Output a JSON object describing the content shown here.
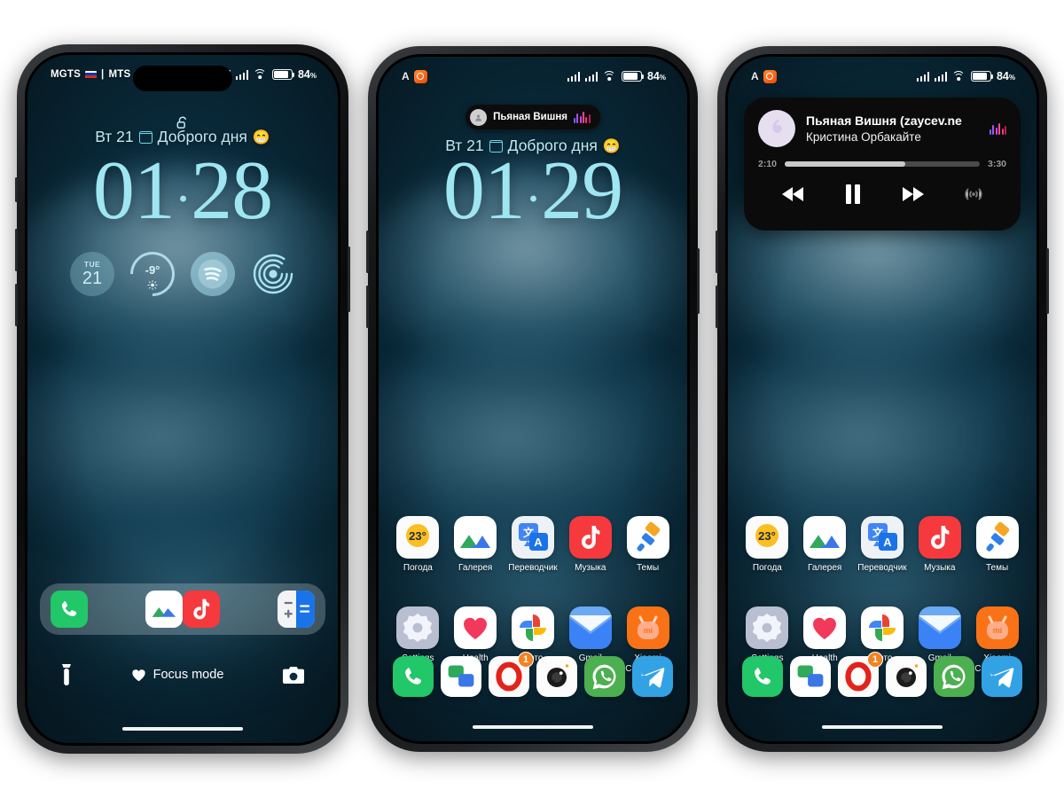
{
  "statusbar": {
    "phone1": {
      "carrier1": "MGTS",
      "separator": "|",
      "carrier2": "MTS",
      "battery": "84",
      "battery_unit": "%"
    },
    "phone2": {
      "letter": "A",
      "battery": "84",
      "battery_unit": "%"
    },
    "phone3": {
      "letter": "A",
      "battery": "84",
      "battery_unit": "%"
    }
  },
  "lockscreen": {
    "date_text": "Вт 21",
    "greeting": "Доброго дня",
    "greeting_emoji": "😁",
    "clock1_h": "01",
    "clock1_sep": "·",
    "clock1_m": "28",
    "clock2_h": "01",
    "clock2_sep": "·",
    "clock2_m": "29",
    "widgets": {
      "calendar_day": "TUE",
      "calendar_date": "21",
      "weather_temp": "-9°",
      "spotify": "spotify-icon",
      "rings": "rings-icon"
    },
    "bottom": {
      "focus_label": "Focus mode",
      "torch": "flashlight-icon",
      "camera": "camera-icon"
    },
    "dock": [
      "phone-icon",
      "gallery-icon",
      "music-icon",
      "calculator-icon"
    ]
  },
  "dynamic_island": {
    "title": "Пьяная Вишня"
  },
  "media_card": {
    "title": "Пьяная Вишня (zaycev.ne",
    "artist": "Кристина Орбакайте",
    "elapsed": "2:10",
    "duration": "3:30",
    "progress_percent": 62,
    "controls": [
      "rewind-button",
      "pause-button",
      "forward-button",
      "airplay-button"
    ]
  },
  "home": {
    "row1": [
      {
        "label": "Погода",
        "icon": "weather-icon",
        "value": "23°"
      },
      {
        "label": "Галерея",
        "icon": "gallery-icon"
      },
      {
        "label": "Переводчик",
        "icon": "translate-icon"
      },
      {
        "label": "Музыка",
        "icon": "music-icon"
      },
      {
        "label": "Темы",
        "icon": "themes-icon"
      }
    ],
    "row2": [
      {
        "label": "Settings",
        "icon": "settings-icon"
      },
      {
        "label": "Health",
        "icon": "health-icon"
      },
      {
        "label": "Фото",
        "icon": "photos-icon"
      },
      {
        "label": "Gmail",
        "icon": "gmail-icon"
      },
      {
        "label": "Xiaomi Community",
        "icon": "xiaomi-community-icon"
      }
    ],
    "dock": [
      {
        "icon": "phone-icon"
      },
      {
        "icon": "messages-icon"
      },
      {
        "icon": "opera-icon",
        "badge": "1"
      },
      {
        "icon": "camera-icon"
      },
      {
        "icon": "whatsapp-icon"
      },
      {
        "icon": "telegram-icon"
      }
    ]
  },
  "colors": {
    "accent_clock": "#9fe6f2",
    "wallpaper": "#0d3d55",
    "badge": "#f5821f"
  }
}
